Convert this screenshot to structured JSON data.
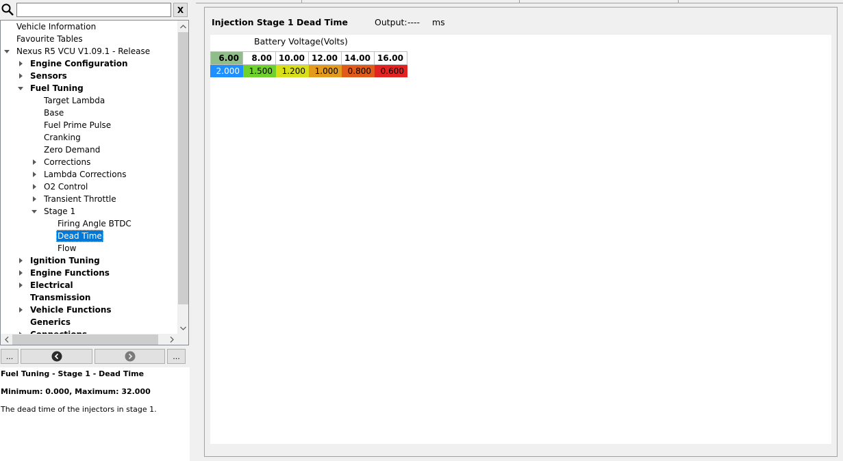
{
  "search": {
    "value": "",
    "clear_label": "X"
  },
  "tree": [
    {
      "label": "Vehicle Information",
      "indent": 0,
      "arrow": "none",
      "bold": false,
      "selected": false
    },
    {
      "label": "Favourite Tables",
      "indent": 0,
      "arrow": "none",
      "bold": false,
      "selected": false
    },
    {
      "label": "Nexus R5 VCU V1.09.1 - Release",
      "indent": 0,
      "arrow": "expanded",
      "bold": false,
      "selected": false
    },
    {
      "label": "Engine Configuration",
      "indent": 1,
      "arrow": "collapsed",
      "bold": true,
      "selected": false
    },
    {
      "label": "Sensors",
      "indent": 1,
      "arrow": "collapsed",
      "bold": true,
      "selected": false
    },
    {
      "label": "Fuel Tuning",
      "indent": 1,
      "arrow": "expanded",
      "bold": true,
      "selected": false
    },
    {
      "label": "Target Lambda",
      "indent": 2,
      "arrow": "none",
      "bold": false,
      "selected": false
    },
    {
      "label": "Base",
      "indent": 2,
      "arrow": "none",
      "bold": false,
      "selected": false
    },
    {
      "label": "Fuel Prime Pulse",
      "indent": 2,
      "arrow": "none",
      "bold": false,
      "selected": false
    },
    {
      "label": "Cranking",
      "indent": 2,
      "arrow": "none",
      "bold": false,
      "selected": false
    },
    {
      "label": "Zero Demand",
      "indent": 2,
      "arrow": "none",
      "bold": false,
      "selected": false
    },
    {
      "label": "Corrections",
      "indent": 2,
      "arrow": "collapsed",
      "bold": false,
      "selected": false
    },
    {
      "label": "Lambda Corrections",
      "indent": 2,
      "arrow": "collapsed",
      "bold": false,
      "selected": false
    },
    {
      "label": "O2 Control",
      "indent": 2,
      "arrow": "collapsed",
      "bold": false,
      "selected": false
    },
    {
      "label": "Transient Throttle",
      "indent": 2,
      "arrow": "collapsed",
      "bold": false,
      "selected": false
    },
    {
      "label": "Stage 1",
      "indent": 2,
      "arrow": "expanded",
      "bold": false,
      "selected": false
    },
    {
      "label": "Firing Angle BTDC",
      "indent": 3,
      "arrow": "none",
      "bold": false,
      "selected": false
    },
    {
      "label": "Dead Time",
      "indent": 3,
      "arrow": "none",
      "bold": false,
      "selected": true
    },
    {
      "label": "Flow",
      "indent": 3,
      "arrow": "none",
      "bold": false,
      "selected": false
    },
    {
      "label": "Ignition Tuning",
      "indent": 1,
      "arrow": "collapsed",
      "bold": true,
      "selected": false
    },
    {
      "label": "Engine Functions",
      "indent": 1,
      "arrow": "collapsed",
      "bold": true,
      "selected": false
    },
    {
      "label": "Electrical",
      "indent": 1,
      "arrow": "collapsed",
      "bold": true,
      "selected": false
    },
    {
      "label": "Transmission",
      "indent": 1,
      "arrow": "none",
      "bold": true,
      "selected": false
    },
    {
      "label": "Vehicle Functions",
      "indent": 1,
      "arrow": "collapsed",
      "bold": true,
      "selected": false
    },
    {
      "label": "Generics",
      "indent": 1,
      "arrow": "none",
      "bold": true,
      "selected": false
    },
    {
      "label": "Connections",
      "indent": 1,
      "arrow": "collapsed",
      "bold": true,
      "selected": false
    }
  ],
  "nav": {
    "left_more": "...",
    "right_more": "..."
  },
  "description": {
    "path": "Fuel Tuning - Stage 1 - Dead Time",
    "range": "Minimum: 0.000, Maximum: 32.000",
    "text": "The dead time of the injectors in stage 1."
  },
  "table": {
    "title": "Injection Stage 1 Dead Time",
    "output_label": "Output:",
    "output_value": "----",
    "output_unit": "ms",
    "axis_title": "Battery Voltage",
    "axis_unit": "(Volts)",
    "active_column": 0,
    "columns": [
      "6.00",
      "8.00",
      "10.00",
      "12.00",
      "14.00",
      "16.00"
    ],
    "values": [
      "2.000",
      "1.500",
      "1.200",
      "1.000",
      "0.800",
      "0.600"
    ],
    "value_colors": [
      "#1e90ff",
      "#6fd12b",
      "#d8df1a",
      "#e49a1c",
      "#e05a1a",
      "#e32222"
    ],
    "value_text_colors": [
      "#ffffff",
      "#000000",
      "#000000",
      "#000000",
      "#000000",
      "#000000"
    ]
  }
}
